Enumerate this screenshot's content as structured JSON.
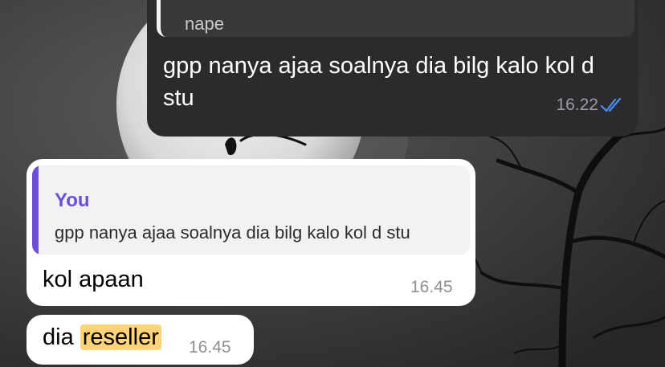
{
  "outgoing": {
    "reply_preview": "nape",
    "text": "gpp nanya ajaa soalnya dia bilg kalo kol d stu",
    "time": "16.22",
    "status_icon": "double-check-icon",
    "colors": {
      "bubble": "#2b2b2d",
      "tick": "#4a8dff"
    }
  },
  "incoming_1": {
    "reply_author": "You",
    "reply_text": "gpp nanya ajaa soalnya dia bilg kalo kol d stu",
    "text": "kol apaan",
    "time": "16.45",
    "colors": {
      "author": "#6b4fd2",
      "bar": "#6e4ed4"
    }
  },
  "incoming_2": {
    "text_before": "dia ",
    "highlight": "reseller",
    "time": "16.45",
    "colors": {
      "highlight": "#ffd37a"
    }
  }
}
